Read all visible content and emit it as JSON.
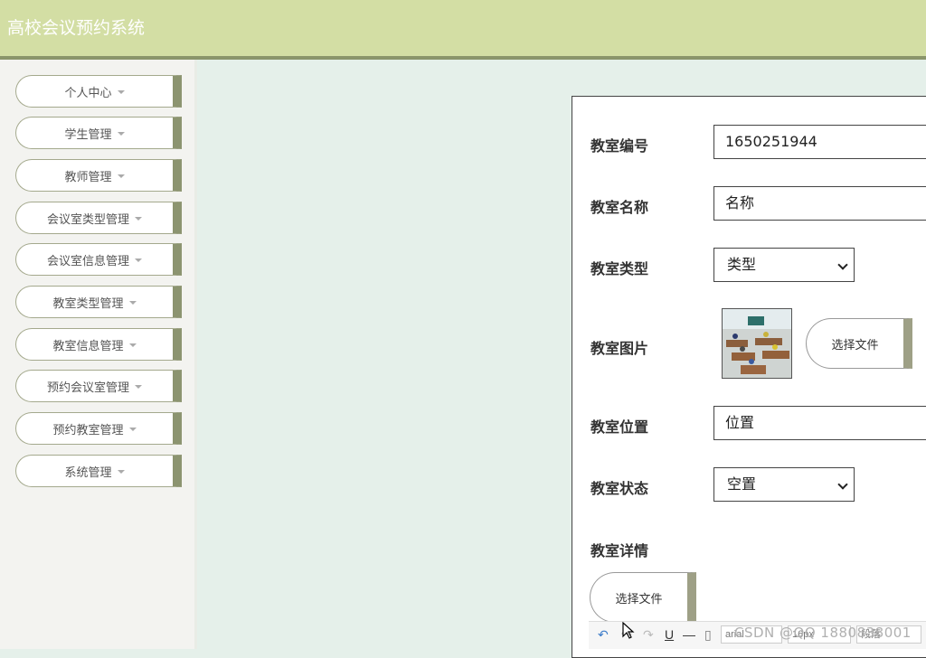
{
  "app": {
    "title": "高校会议预约系统"
  },
  "sidebar": {
    "items": [
      {
        "label": "个人中心"
      },
      {
        "label": "学生管理"
      },
      {
        "label": "教师管理"
      },
      {
        "label": "会议室类型管理"
      },
      {
        "label": "会议室信息管理"
      },
      {
        "label": "教室类型管理"
      },
      {
        "label": "教室信息管理"
      },
      {
        "label": "预约会议室管理"
      },
      {
        "label": "预约教室管理"
      },
      {
        "label": "系统管理"
      }
    ]
  },
  "form": {
    "room_number": {
      "label": "教室编号",
      "value": "1650251944"
    },
    "room_name": {
      "label": "教室名称",
      "placeholder": "名称"
    },
    "room_type": {
      "label": "教室类型",
      "selected": "类型"
    },
    "room_image": {
      "label": "教室图片",
      "button": "选择文件"
    },
    "room_location": {
      "label": "教室位置",
      "placeholder": "位置"
    },
    "room_status": {
      "label": "教室状态",
      "selected": "空置"
    },
    "room_details": {
      "label": "教室详情",
      "button": "选择文件"
    }
  },
  "editor_toolbar": {
    "font_family": "arial",
    "font_size": "16px",
    "paragraph": "段落",
    "icons": [
      "undo-icon",
      "redo-icon",
      "underline-icon",
      "horizontal-rule-icon",
      "paste-icon"
    ]
  },
  "watermark": {
    "text": "CSDN @QQ 1880838001"
  }
}
